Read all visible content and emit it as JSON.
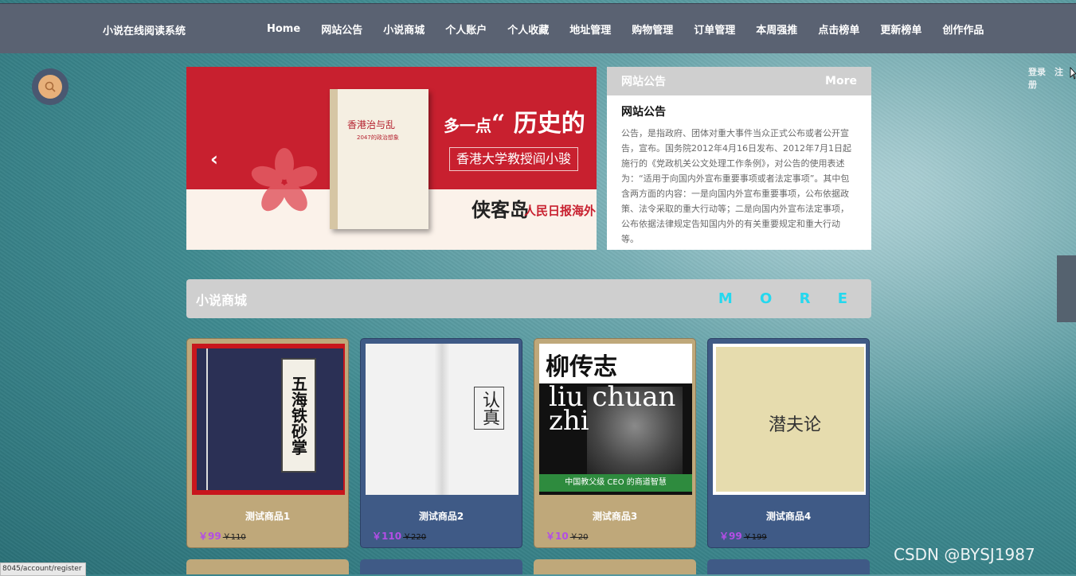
{
  "header": {
    "brand": "小说在线阅读系统",
    "nav": [
      "Home",
      "网站公告",
      "小说商城",
      "个人账户",
      "个人收藏",
      "地址管理",
      "购物管理",
      "订单管理",
      "本周强推",
      "点击榜单",
      "更新榜单",
      "创作作品"
    ]
  },
  "auth": {
    "login": "登录",
    "register": "注册"
  },
  "banner": {
    "book_title": "香港治与乱",
    "book_subtitle": "2047的政治想象",
    "headline_prefix": "多一点",
    "headline_main": "“ 历史的",
    "sub": "香港大学教授阎小骏",
    "brand_a": "侠客岛",
    "brand_b": "人民日报海外"
  },
  "notice": {
    "header": "网站公告",
    "more": "More",
    "title": "网站公告",
    "body": "公告，是指政府、团体对重大事件当众正式公布或者公开宣告，宣布。国务院2012年4月16日发布、2012年7月1日起施行的《党政机关公文处理工作条例》，对公告的使用表述为：“适用于向国内外宣布重要事项或者法定事项”。其中包含两方面的内容：一是向国内外宣布重要事项，公布依据政策、法令采取的重大行动等；二是向国内外宣布法定事项，公布依据法律规定告知国内外的有关重要规定和重大行动等。"
  },
  "shop": {
    "title": "小说商城",
    "more": "M O R E",
    "products": [
      {
        "name": "测试商品1",
        "price": "￥99",
        "old_price": "￥110",
        "cover_text": "五海铁砂掌"
      },
      {
        "name": "测试商品2",
        "price": "￥110",
        "old_price": "￥220",
        "cover_text": "认真"
      },
      {
        "name": "测试商品3",
        "price": "￥10",
        "old_price": "￥20",
        "cover_text": "柳传志",
        "cover_pinyin": "liu chuan zhi",
        "cover_bar": "中国教父级 CEO 的商道智慧"
      },
      {
        "name": "测试商品4",
        "price": "￥99",
        "old_price": "￥199",
        "cover_text": "潜夫论"
      }
    ]
  },
  "status_url": "8045/account/register",
  "watermark": "CSDN @BYSJ1987",
  "colors": {
    "nav_bg": "#5a6272",
    "card_gold": "#bfa87a",
    "card_blue": "#3f5a86",
    "price": "#b34ee6",
    "more_accent": "#25d8ee"
  }
}
